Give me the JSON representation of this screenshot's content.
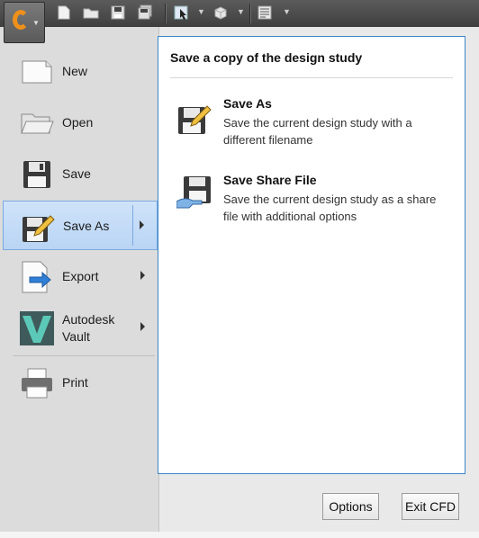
{
  "menu": {
    "items": [
      {
        "label": "New",
        "icon": "new-file-icon"
      },
      {
        "label": "Open",
        "icon": "open-folder-icon"
      },
      {
        "label": "Save",
        "icon": "save-icon"
      },
      {
        "label": "Save As",
        "icon": "save-as-icon",
        "active": true
      },
      {
        "label": "Export",
        "icon": "export-icon"
      },
      {
        "label": "Autodesk Vault",
        "icon": "vault-icon"
      },
      {
        "label": "Print",
        "icon": "printer-icon"
      }
    ]
  },
  "panel": {
    "title": "Save a copy of the design study",
    "options": [
      {
        "title": "Save As",
        "description": "Save the current design study with a different filename"
      },
      {
        "title": "Save Share File",
        "description": "Save the current design study as a share file with additional options"
      }
    ]
  },
  "footer": {
    "options_label": "Options",
    "exit_label": "Exit CFD"
  },
  "colors": {
    "accent_orange": "#f0901a",
    "highlight_blue": "#b9d5f4",
    "panel_border": "#3c86c8"
  }
}
